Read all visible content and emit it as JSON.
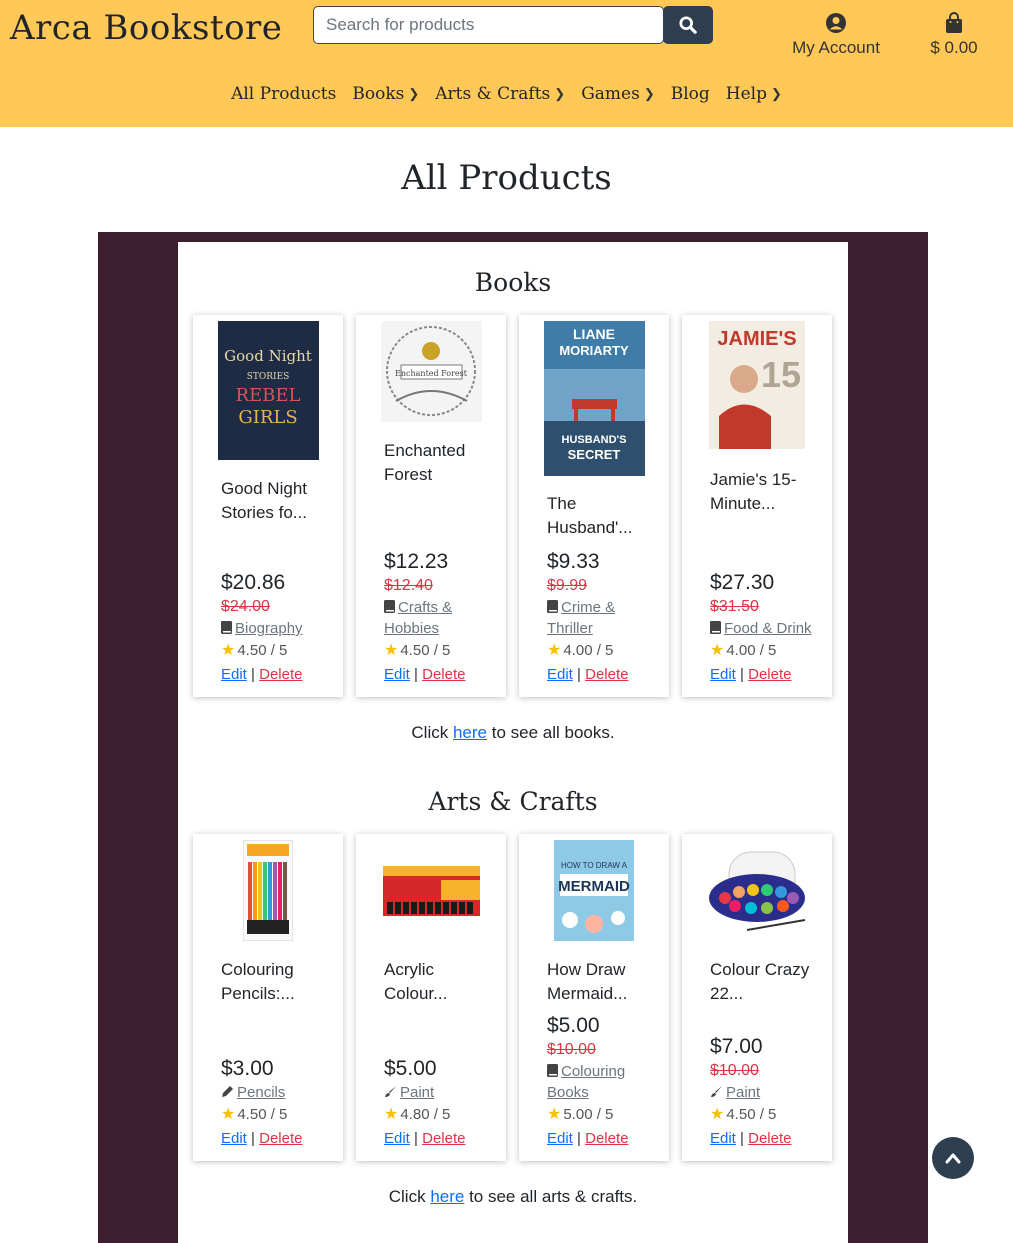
{
  "header": {
    "logo": "Arca Bookstore",
    "search_placeholder": "Search for products",
    "account_label": "My Account",
    "cart_total": "$ 0.00"
  },
  "nav": [
    {
      "label": "All Products",
      "has_chevron": false
    },
    {
      "label": "Books",
      "has_chevron": true
    },
    {
      "label": "Arts & Crafts",
      "has_chevron": true
    },
    {
      "label": "Games",
      "has_chevron": true
    },
    {
      "label": "Blog",
      "has_chevron": false
    },
    {
      "label": "Help",
      "has_chevron": true
    }
  ],
  "page_title": "All Products",
  "sections": [
    {
      "title": "Books",
      "products": [
        {
          "name": "Good Night Stories fo...",
          "price": "$20.86",
          "old_price": "$24.00",
          "category": "Biography",
          "category_icon": "book-icon",
          "rating": "4.50 / 5",
          "image": "good-night-stories-cover"
        },
        {
          "name": "Enchanted Forest",
          "price": "$12.23",
          "old_price": "$12.40",
          "category": "Crafts & Hobbies",
          "category_icon": "book-icon",
          "rating": "4.50 / 5",
          "image": "enchanted-forest-cover"
        },
        {
          "name": "The Husband'...",
          "price": "$9.33",
          "old_price": "$9.99",
          "category": "Crime & Thriller",
          "category_icon": "book-icon",
          "rating": "4.00 / 5",
          "image": "husbands-secret-cover"
        },
        {
          "name": "Jamie's 15-Minute...",
          "price": "$27.30",
          "old_price": "$31.50",
          "category": "Food & Drink",
          "category_icon": "book-icon",
          "rating": "4.00 / 5",
          "image": "jamies-15-minute-cover"
        }
      ],
      "see_all_prefix": "Click ",
      "see_all_link": "here",
      "see_all_suffix": " to see all books."
    },
    {
      "title": "Arts & Crafts",
      "products": [
        {
          "name": "Colouring Pencils:...",
          "price": "$3.00",
          "old_price": "",
          "category": "Pencils",
          "category_icon": "pencil-icon",
          "rating": "4.50 / 5",
          "image": "colouring-pencils-pack"
        },
        {
          "name": "Acrylic Colour...",
          "price": "$5.00",
          "old_price": "",
          "category": "Paint",
          "category_icon": "paintbrush-icon",
          "rating": "4.80 / 5",
          "image": "acrylic-paint-set"
        },
        {
          "name": "How Draw Mermaid...",
          "price": "$5.00",
          "old_price": "$10.00",
          "category": "Colouring Books",
          "category_icon": "book-icon",
          "rating": "5.00 / 5",
          "image": "draw-mermaid-cover"
        },
        {
          "name": "Colour Crazy 22...",
          "price": "$7.00",
          "old_price": "$10.00",
          "category": "Paint",
          "category_icon": "paintbrush-icon",
          "rating": "4.50 / 5",
          "image": "watercolour-palette"
        }
      ],
      "see_all_prefix": "Click ",
      "see_all_link": "here",
      "see_all_suffix": " to see all arts & crafts."
    }
  ],
  "card_actions": {
    "edit": "Edit",
    "separator": "|",
    "delete": "Delete"
  },
  "colors": {
    "header_bg": "#ffc857",
    "frame_bg": "#3e1f2f",
    "button_dark": "#2d3e50",
    "link": "#0d6efd",
    "danger": "#dc3545",
    "star": "#f7c000"
  }
}
